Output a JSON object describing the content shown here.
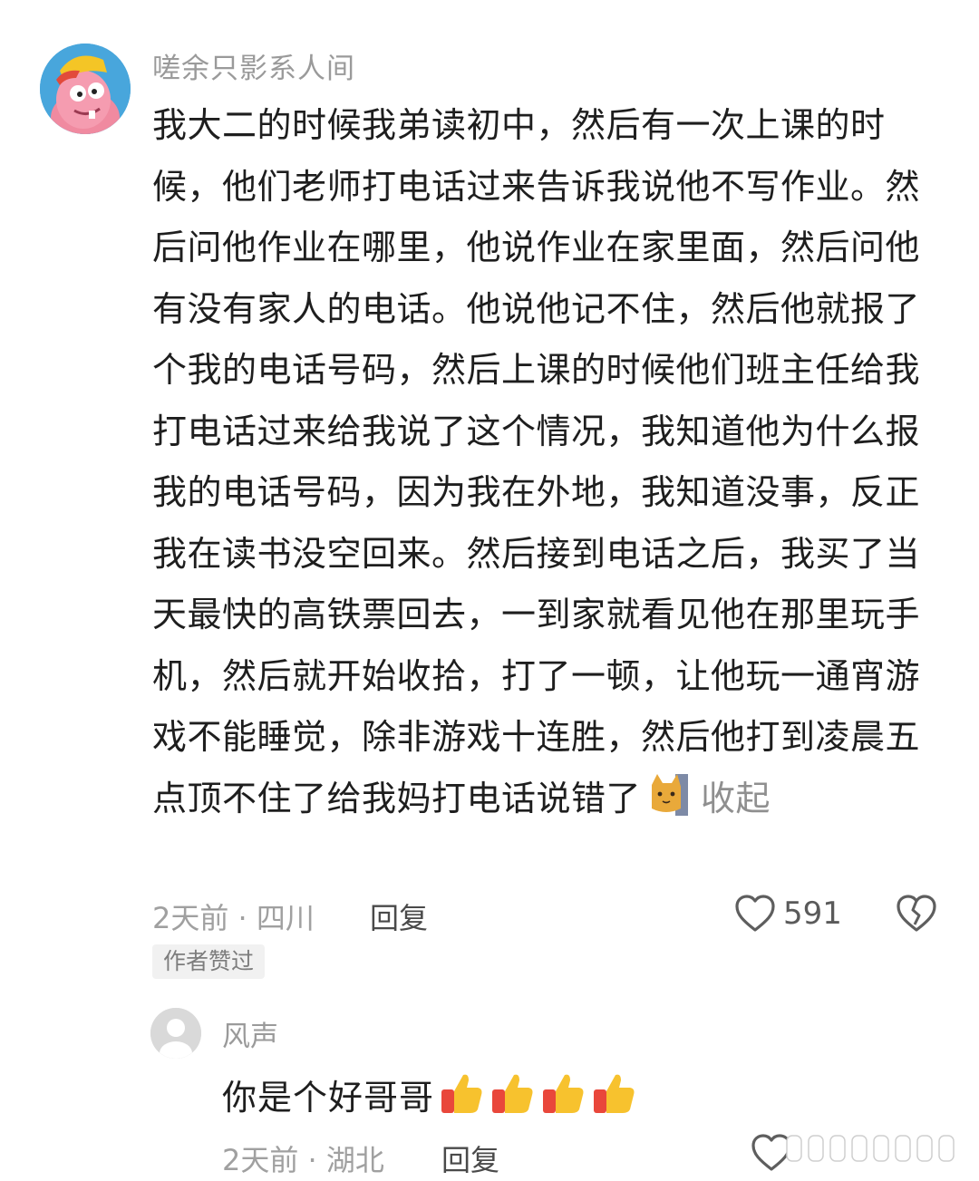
{
  "comment": {
    "username": "嗟余只影系人间",
    "text": "我大二的时候我弟读初中，然后有一次上课的时候，他们老师打电话过来告诉我说他不写作业。然后问他作业在哪里，他说作业在家里面，然后问他有没有家人的电话。他说他记不住，然后他就报了个我的电话号码，然后上课的时候他们班主任给我打电话过来给我说了这个情况，我知道他为什么报我的电话号码，因为我在外地，我知道没事，反正我在读书没空回来。然后接到电话之后，我买了当天最快的高铁票回去，一到家就看见他在那里玩手机，然后就开始收拾，打了一顿，让他玩一通宵游戏不能睡觉，除非游戏十连胜，然后他打到凌晨五点顶不住了给我妈打电话说错了",
    "collapse_label": "收起",
    "meta": "2天前 · 四川",
    "reply_label": "回复",
    "likes": "591",
    "author_badge": "作者赞过"
  },
  "reply": {
    "username": "风声",
    "text": "你是个好哥哥",
    "meta": "2天前 · 湖北",
    "reply_label": "回复"
  },
  "icons": {
    "heart": "heart-outline-icon",
    "dislike": "broken-heart-icon",
    "thumbs_up": "thumbs-up-emoji",
    "cat": "cat-emoji"
  },
  "colors": {
    "meta_text": "#a0a0a0",
    "badge_bg": "#f1f1f1",
    "thumb_yellow": "#f7c22e",
    "thumb_red": "#e9473b"
  }
}
